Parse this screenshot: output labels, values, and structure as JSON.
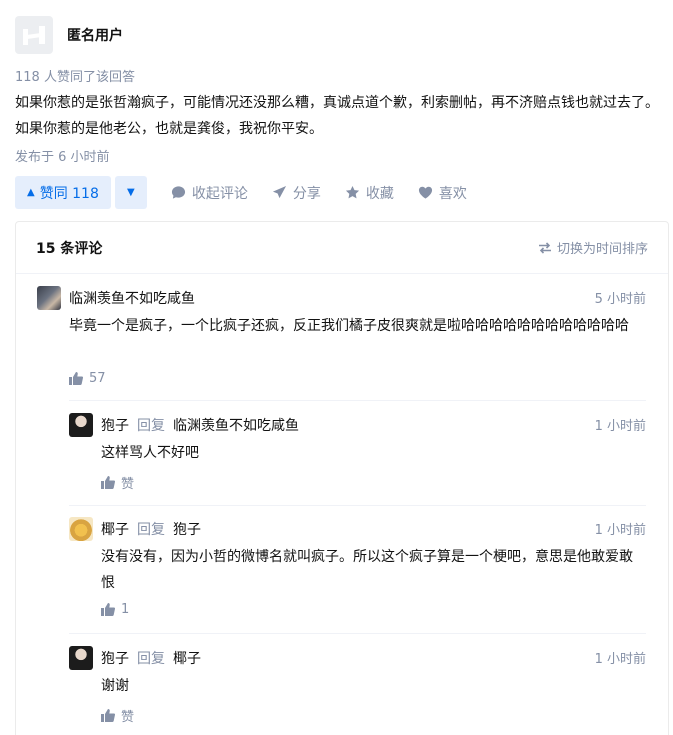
{
  "author": {
    "name": "匿名用户"
  },
  "answer": {
    "vote_summary": "118 人赞同了该回答",
    "text": "如果你惹的是张哲瀚疯子，可能情况还没那么糟，真诚点道个歉，利索删帖，再不济赔点钱也就过去了。如果你惹的是他老公，也就是龚俊，我祝你平安。",
    "published": "发布于 6 小时前"
  },
  "actions": {
    "vote_up_label": "赞同 118",
    "collapse_comments": "收起评论",
    "share": "分享",
    "favorite": "收藏",
    "like": "喜欢"
  },
  "comments": {
    "title": "15 条评论",
    "sort_toggle": "切换为时间排序",
    "items": [
      {
        "author": "临渊羡鱼不如吃咸鱼",
        "time": "5 小时前",
        "text": "毕竟一个是疯子，一个比疯子还疯，反正我们橘子皮很爽就是啦哈哈哈哈哈哈哈哈哈哈哈哈",
        "likes": "57"
      },
      {
        "author": "狍子",
        "reply_word": "回复",
        "reply_to": "临渊羡鱼不如吃咸鱼",
        "time": "1 小时前",
        "text": "这样骂人不好吧",
        "likes": "赞"
      },
      {
        "author": "椰子",
        "reply_word": "回复",
        "reply_to": "狍子",
        "time": "1 小时前",
        "text": "没有没有，因为小哲的微博名就叫疯子。所以这个疯子算是一个梗吧，意思是他敢爱敢恨",
        "likes": "1"
      },
      {
        "author": "狍子",
        "reply_word": "回复",
        "reply_to": "椰子",
        "time": "1 小时前",
        "text": "谢谢",
        "likes": "赞"
      }
    ]
  },
  "colors": {
    "accent": "#056de8",
    "accent_bg": "#e5eefc",
    "muted": "#8590a6"
  }
}
